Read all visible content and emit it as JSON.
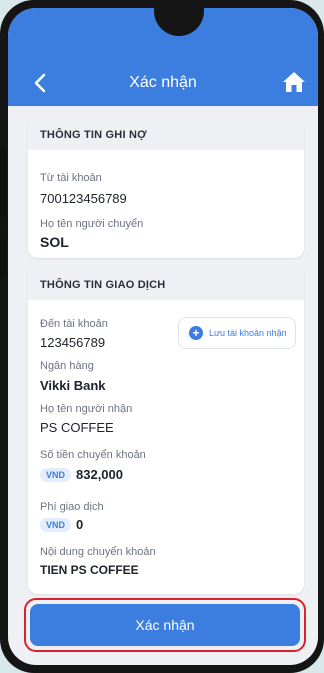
{
  "header": {
    "title": "Xác nhận"
  },
  "debit": {
    "section_title": "THÔNG TIN GHI NỢ",
    "from_account_label": "Từ tài khoản",
    "from_account_value": "700123456789",
    "sender_name_label": "Họ tên người chuyển",
    "sender_name_value": "SOL"
  },
  "transaction": {
    "section_title": "THÔNG TIN GIAO DỊCH",
    "to_account_label": "Đến tài khoản",
    "to_account_value": "123456789",
    "save_account_button": "Lưu tài khoản nhận",
    "bank_label": "Ngân hàng",
    "bank_value": "Vikki Bank",
    "recipient_label": "Họ tên người nhận",
    "recipient_value": "PS COFFEE",
    "amount_label": "Số tiền chuyển khoản",
    "amount_currency": "VND",
    "amount_value": "832,000",
    "fee_label": "Phí giao dịch",
    "fee_currency": "VND",
    "fee_value": "0",
    "content_label": "Nội dung chuyển khoản",
    "content_value": "TIEN PS COFFEE"
  },
  "footer": {
    "confirm_button": "Xác nhận"
  },
  "colors": {
    "accent": "#3b7ee0",
    "highlight": "#d8232e"
  },
  "icons": {
    "back": "chevron-left-icon",
    "home": "home-icon",
    "add": "plus-circle-icon"
  }
}
